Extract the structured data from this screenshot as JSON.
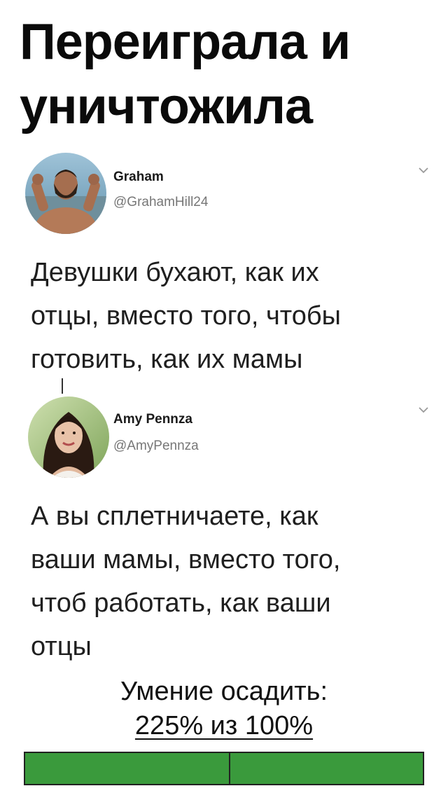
{
  "headline": {
    "line1": "Переиграла и",
    "line2": "уничтожила"
  },
  "tweets": [
    {
      "name": "Graham",
      "handle": "@GrahamHill24",
      "lines": [
        "Девушки бухают, как их",
        "отцы, вместо того, чтобы",
        "готовить, как их мамы"
      ],
      "avatar_icon": "man-avatar-photo"
    },
    {
      "name": "Amy Pennza",
      "handle": "@AmyPennza",
      "lines": [
        "А вы сплетничаете, как",
        "ваши мамы, вместо того,",
        "чтоб работать, как ваши",
        "отцы"
      ],
      "avatar_icon": "woman-avatar-photo"
    }
  ],
  "footer": {
    "line1": "Умение осадить:",
    "line2": "225% из 100%"
  },
  "progress": {
    "value_percent": 225,
    "max_percent": 100,
    "color": "#3a9a3c"
  }
}
